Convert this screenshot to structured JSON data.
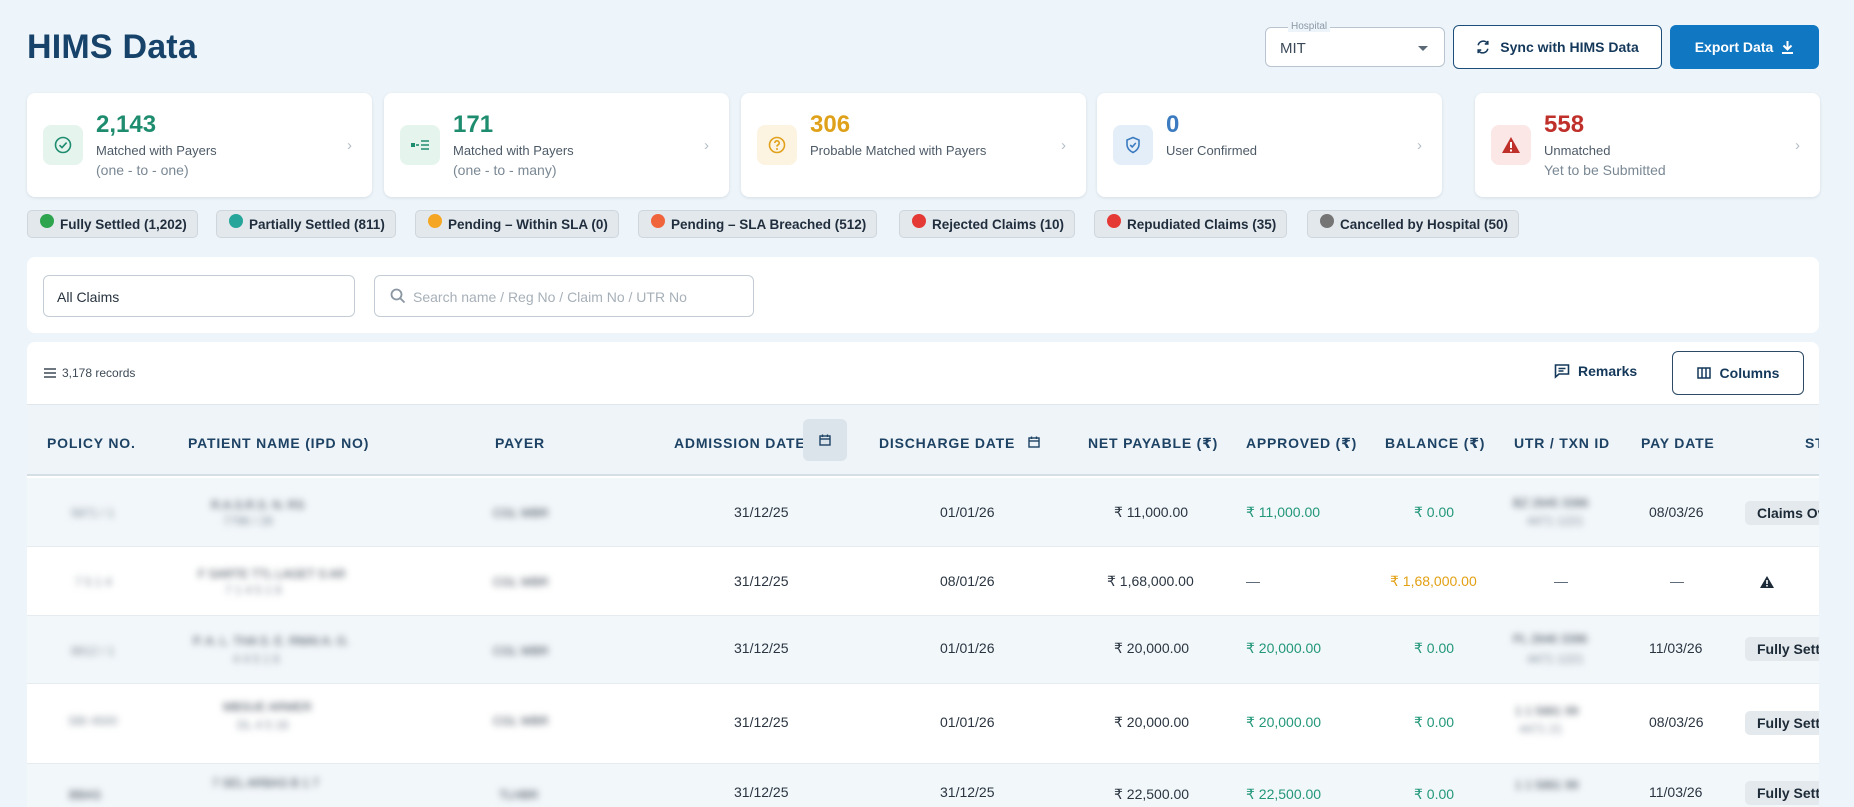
{
  "header": {
    "title": "HIMS Data",
    "hospital_legend": "Hospital",
    "hospital_value": "MIT",
    "sync_label": "Sync with HIMS Data",
    "export_label": "Export Data"
  },
  "stats": [
    {
      "value": "2,143",
      "label": "Matched with Payers",
      "sub": "(one - to - one)",
      "color": "#1e8c6e",
      "icon": "check-circle-icon"
    },
    {
      "value": "171",
      "label": "Matched with Payers",
      "sub": "(one - to - many)",
      "color": "#1e8c6e",
      "icon": "link-list-icon"
    },
    {
      "value": "306",
      "label": "Probable Matched with Payers",
      "sub": "",
      "color": "#e0a11a",
      "icon": "question-circle-icon"
    },
    {
      "value": "0",
      "label": "User Confirmed",
      "sub": "",
      "color": "#3c7bc0",
      "icon": "shield-check-icon"
    },
    {
      "value": "558",
      "label": "Unmatched",
      "sub": "Yet to be Submitted",
      "color": "#c0302b",
      "icon": "warning-triangle-icon"
    }
  ],
  "chips": [
    {
      "label": "Fully Settled (1,202)",
      "color": "#2ea44f"
    },
    {
      "label": "Partially Settled (811)",
      "color": "#26a69a"
    },
    {
      "label": "Pending – Within SLA (0)",
      "color": "#f5a623"
    },
    {
      "label": "Pending – SLA Breached (512)",
      "color": "#f0643c"
    },
    {
      "label": "Rejected Claims (10)",
      "color": "#e53935"
    },
    {
      "label": "Repudiated Claims (35)",
      "color": "#e53935"
    },
    {
      "label": "Cancelled by Hospital (50)",
      "color": "#757575"
    }
  ],
  "filters": {
    "claims_select": "All Claims",
    "search_placeholder": "Search name / Reg No / Claim No / UTR No"
  },
  "table": {
    "records": "3,178 records",
    "remarks_label": "Remarks",
    "columns_label": "Columns",
    "headers": {
      "policy": "POLICY NO.",
      "patient": "PATIENT NAME (IPD NO)",
      "payer": "PAYER",
      "admission": "ADMISSION DATE",
      "discharge": "DISCHARGE DATE",
      "net": "NET PAYABLE (₹)",
      "approved": "APPROVED (₹)",
      "balance": "BALANCE (₹)",
      "utr": "UTR / TXN ID",
      "paydate": "PAY DATE",
      "status": "ST"
    },
    "rows": [
      {
        "policy": "5871 / 1",
        "patient": "R.A.S.R.S. N.   RS",
        "ipd": "7796 / 26",
        "payer": "CGL WBR",
        "admission": "31/12/25",
        "discharge": "01/01/26",
        "net": "₹ 11,000.00",
        "approved": "₹ 11,000.00",
        "balance": "₹ 0.00",
        "utr": "BZ 2645 3396",
        "utr2": "4471 1221",
        "paydate": "08/03/26",
        "status": "Claims Ov"
      },
      {
        "policy": "7 5 1 4",
        "patient": "F SARTE TTL LAGET S AR",
        "ipd": "7 1 4 5   1 6",
        "payer": "CGL WBR",
        "admission": "31/12/25",
        "discharge": "08/01/26",
        "net": "₹ 1,68,000.00",
        "approved": "—",
        "balance": "₹ 1,68,000.00",
        "utr": "—",
        "utr2": "",
        "paydate": "—",
        "status": ""
      },
      {
        "policy": "8812 / 1",
        "patient": "P. A. L. THA S. E.   RMAI A. G.",
        "ipd": "4 4 5   1 6",
        "payer": "CGL WBR",
        "admission": "31/12/25",
        "discharge": "01/01/26",
        "net": "₹ 20,000.00",
        "approved": "₹ 20,000.00",
        "balance": "₹ 0.00",
        "utr": "PL 2646 3396",
        "utr2": "4471 1221",
        "paydate": "11/03/26",
        "status": "Fully Sett"
      },
      {
        "policy": "SBI 4500",
        "patient": "MBSUE   ARMER",
        "ipd": "DL   4 5 16",
        "payer": "CGL WBR",
        "admission": "31/12/25",
        "discharge": "01/01/26",
        "net": "₹ 20,000.00",
        "approved": "₹ 20,000.00",
        "balance": "₹ 0.00",
        "utr": "1 1 5881  99",
        "utr2": "4471   21",
        "paydate": "08/03/26",
        "status": "Fully Sett"
      },
      {
        "policy": "BBAS",
        "patient": "7 SEL ARBAS B 1 7",
        "ipd": "",
        "payer": "TLHBR",
        "admission": "31/12/25",
        "discharge": "31/12/25",
        "net": "₹ 22,500.00",
        "approved": "₹ 22,500.00",
        "balance": "₹ 0.00",
        "utr": "1 1 5881  99",
        "utr2": "",
        "paydate": "11/03/26",
        "status": "Fully Sett"
      }
    ]
  }
}
